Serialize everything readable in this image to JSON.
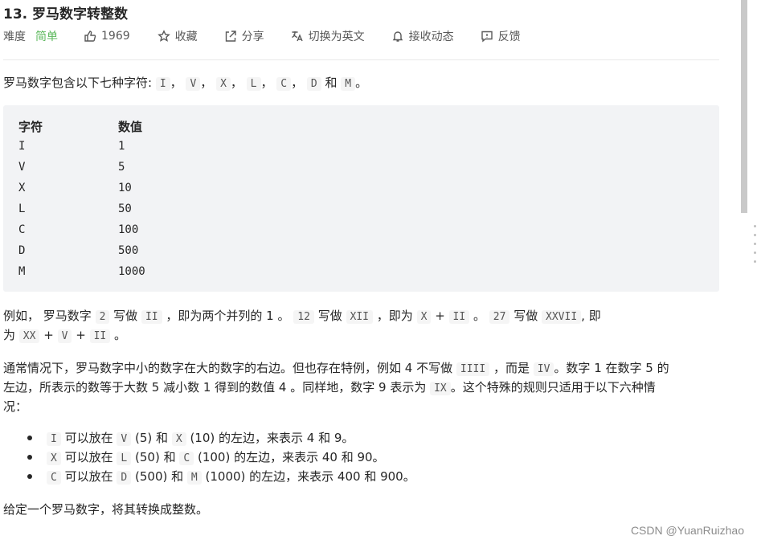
{
  "problem": {
    "title": "13. 罗马数字转整数",
    "difficulty_label": "难度",
    "difficulty_value": "简单",
    "likes": "1969",
    "favorite": "收藏",
    "share": "分享",
    "translate": "切换为英文",
    "subscribe": "接收动态",
    "feedback": "反馈"
  },
  "intro": {
    "text": "罗马数字包含以下七种字符:",
    "symbols": [
      "I",
      "V",
      "X",
      "L",
      "C",
      "D",
      "M"
    ],
    "and": "和",
    "end": "。"
  },
  "table": {
    "header": [
      "字符",
      "数值"
    ],
    "rows": [
      [
        "I",
        "1"
      ],
      [
        "V",
        "5"
      ],
      [
        "X",
        "10"
      ],
      [
        "L",
        "50"
      ],
      [
        "C",
        "100"
      ],
      [
        "D",
        "500"
      ],
      [
        "M",
        "1000"
      ]
    ]
  },
  "example": {
    "t1": "例如， 罗马数字",
    "c1": "2",
    "t2": "写做",
    "c2": "II",
    "t3": "，即为两个并列的 1 。",
    "c3": "12",
    "t4": "写做",
    "c4": "XII",
    "t5": "，即为",
    "c5": "X",
    "t6": "+",
    "c6": "II",
    "t7": "。",
    "c7": "27",
    "t8": "写做",
    "c8": "XXVII",
    "t9": ", 即",
    "t10": "为",
    "c9": "XX",
    "t11": "+",
    "c10": "V",
    "t12": "+",
    "c11": "II",
    "t13": "。"
  },
  "rule": {
    "t1": "通常情况下，罗马数字中小的数字在大的数字的右边。但也存在特例，例如 4 不写做",
    "c1": "IIII",
    "t2": "，而是",
    "c2": "IV",
    "t3": "。数字 1 在数字 5 的",
    "t4": "左边，所表示的数等于大数 5 减小数 1 得到的数值 4 。同样地，数字 9 表示为",
    "c3": "IX",
    "t5": "。这个特殊的规则只适用于以下六种情",
    "t6": "况："
  },
  "cases": [
    {
      "a": "I",
      "t1": "可以放在",
      "b": "V",
      "t2": "(5) 和",
      "c": "X",
      "t3": "(10) 的左边，来表示 4 和 9。"
    },
    {
      "a": "X",
      "t1": "可以放在",
      "b": "L",
      "t2": "(50) 和",
      "c": "C",
      "t3": "(100) 的左边，来表示 40 和 90。"
    },
    {
      "a": "C",
      "t1": "可以放在",
      "b": "D",
      "t2": "(500) 和",
      "c": "M",
      "t3": "(1000) 的左边，来表示 400 和 900。"
    }
  ],
  "task": "给定一个罗马数字，将其转换成整数。",
  "watermark": "CSDN @YuanRuizhao",
  "colors": {
    "easy": "#5cb85c",
    "code_bg": "#f2f3f5"
  }
}
